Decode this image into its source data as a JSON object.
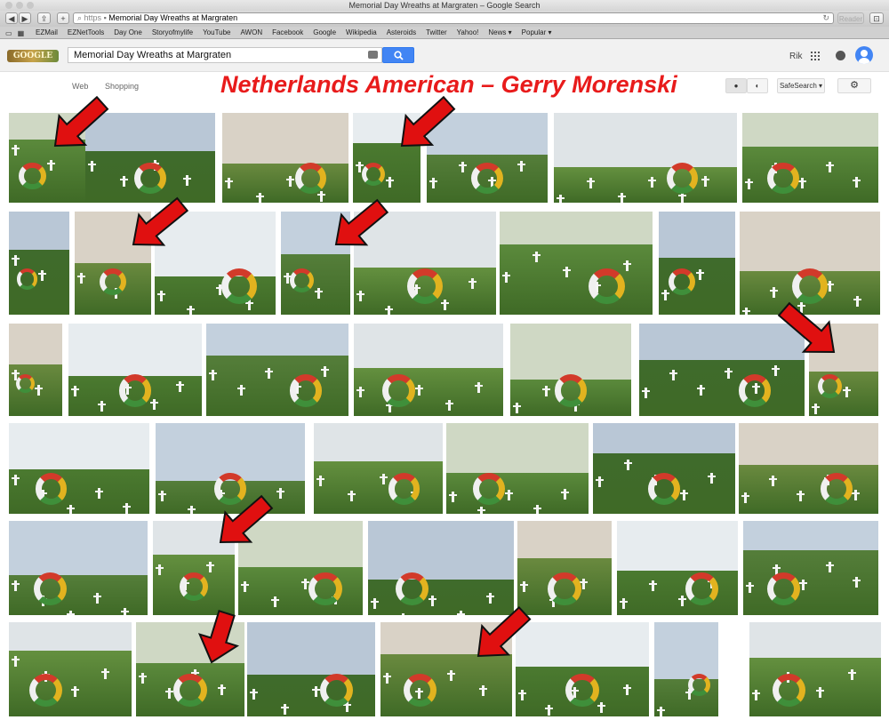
{
  "window": {
    "title": "Memorial Day Wreaths at Margraten – Google Search"
  },
  "toolbar": {
    "url_scheme": "https",
    "url_text": "Memorial Day Wreaths at Margraten",
    "reader_label": "Reader"
  },
  "bookmarks": [
    "EZMail",
    "EZNetTools",
    "Day One",
    "Storyofmylife",
    "YouTube",
    "AWON",
    "Facebook",
    "Google",
    "Wikipedia",
    "Asteroids",
    "Twitter",
    "Yahoo!",
    "News ▾",
    "Popular ▾"
  ],
  "search": {
    "query": "Memorial Day Wreaths at Margraten"
  },
  "header": {
    "user": "Rik"
  },
  "nav": {
    "web": "Web",
    "shopping": "Shopping"
  },
  "headline": "Netherlands American – Gerry Morenski",
  "controls": {
    "safesearch": "SafeSearch ▾"
  },
  "colors": {
    "accent": "#4285f4",
    "headline": "#e81b1b",
    "arrow": "#e01010"
  },
  "results_rows": [
    {
      "row": 1,
      "thumbnails": 7,
      "highlighted": [
        1,
        4
      ]
    },
    {
      "row": 2,
      "thumbnails": 8,
      "highlighted": [
        2,
        5
      ]
    },
    {
      "row": 3,
      "thumbnails": 8,
      "highlighted": [
        8
      ]
    },
    {
      "row": 4,
      "thumbnails": 7,
      "highlighted": []
    },
    {
      "row": 5,
      "thumbnails": 7,
      "highlighted": [
        2
      ]
    },
    {
      "row": 6,
      "thumbnails": 8,
      "highlighted": [
        2,
        4
      ]
    }
  ]
}
